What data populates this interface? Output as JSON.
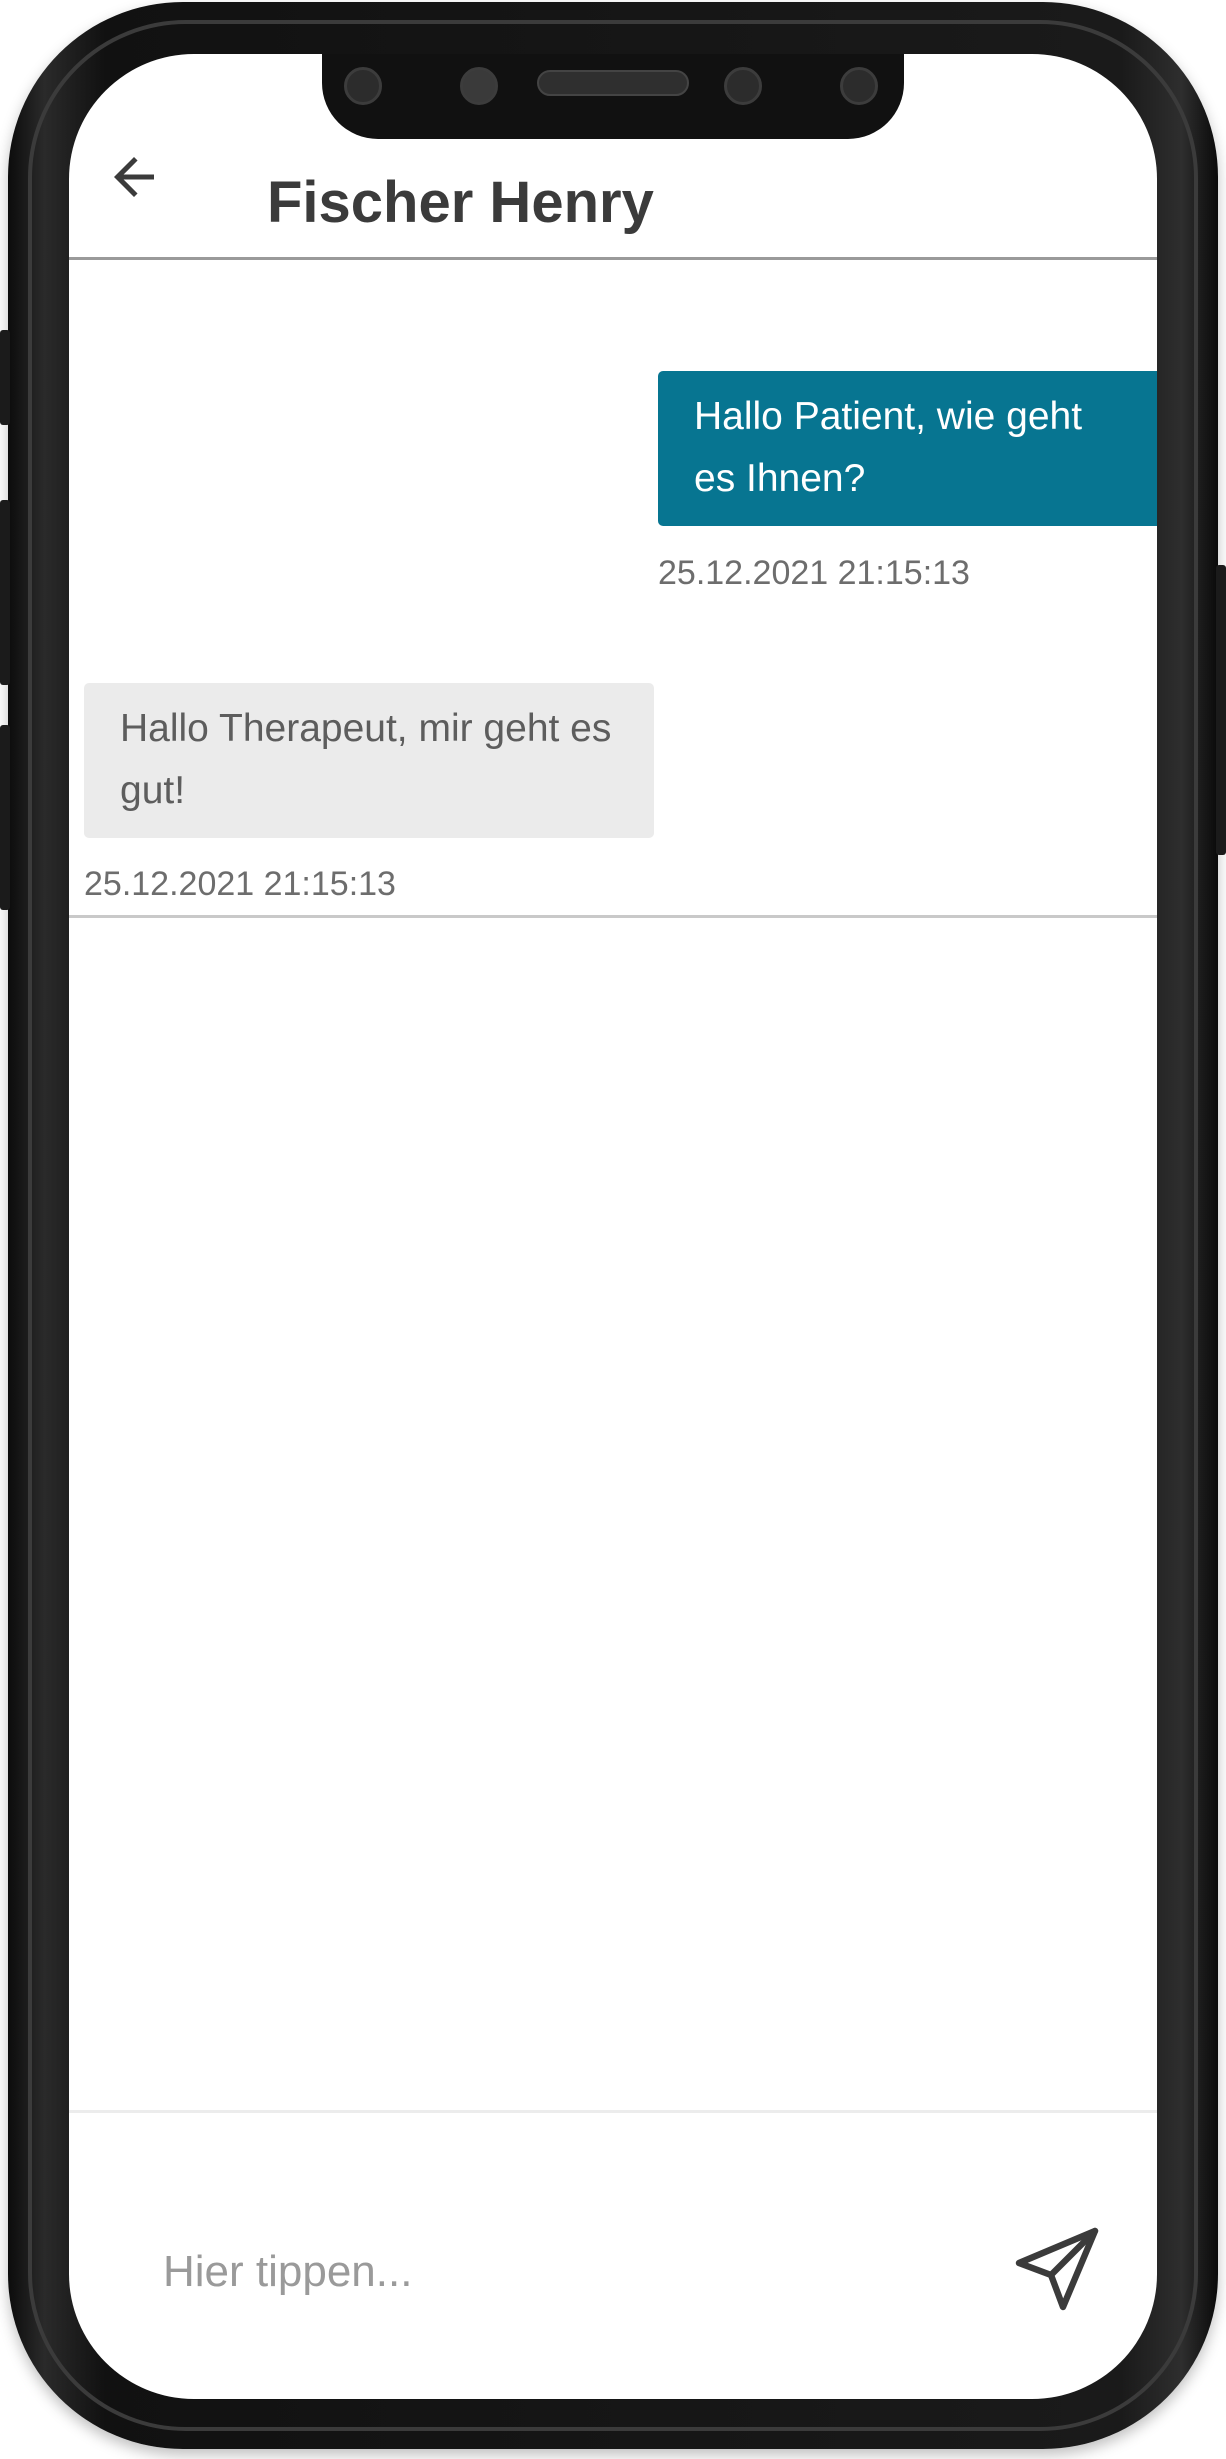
{
  "header": {
    "title": "Fischer Henry",
    "back_icon": "arrow-left-icon"
  },
  "messages": [
    {
      "direction": "sent",
      "text": "Hallo Patient, wie geht es Ihnen?",
      "timestamp": "25.12.2021 21:15:13"
    },
    {
      "direction": "received",
      "text": "Hallo Therapeut, mir geht es gut!",
      "timestamp": "25.12.2021 21:15:13"
    }
  ],
  "composer": {
    "placeholder": "Hier tippen...",
    "value": "",
    "send_icon": "send-icon"
  },
  "colors": {
    "sent_bubble": "#077591",
    "received_bubble": "#EBEBEB",
    "title_text": "#3B3B3B",
    "frame": "#111111"
  }
}
